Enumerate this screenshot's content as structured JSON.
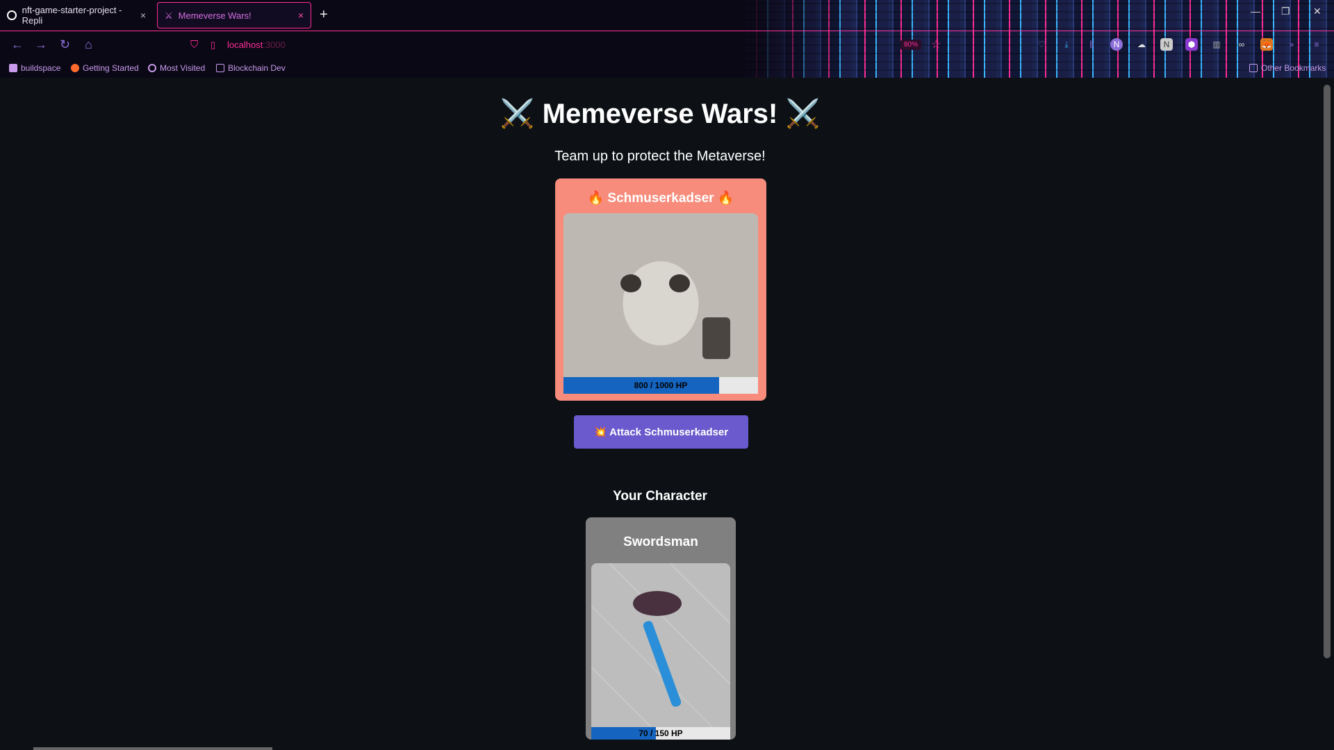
{
  "browser": {
    "tabs": [
      {
        "title": "nft-game-starter-project - Repli",
        "close": "×"
      },
      {
        "title": "Memeverse Wars!",
        "close": "×"
      }
    ],
    "new_tab": "+",
    "url_host": "localhost",
    "url_port": ":3000",
    "zoom": "80%",
    "bookmarks": [
      "buildspace",
      "Getting Started",
      "Most Visited",
      "Blockchain Dev"
    ],
    "other_bookmarks": "Other Bookmarks",
    "accent": "#ff2d95"
  },
  "page": {
    "title": "⚔️ Memeverse Wars! ⚔️",
    "subtitle": "Team up to protect the Metaverse!",
    "boss": {
      "name": "🔥 Schmuserkadser 🔥",
      "hp": 800,
      "max_hp": 1000,
      "hp_label": "800 / 1000 HP",
      "card_color": "#f78c7c"
    },
    "attack_button": "💥 Attack Schmuserkadser",
    "your_character_heading": "Your Character",
    "player": {
      "name": "Swordsman",
      "hp": 70,
      "max_hp": 150,
      "hp_label": "70 / 150 HP",
      "card_color": "#808080"
    },
    "hp_fill_color": "#1565c0"
  }
}
